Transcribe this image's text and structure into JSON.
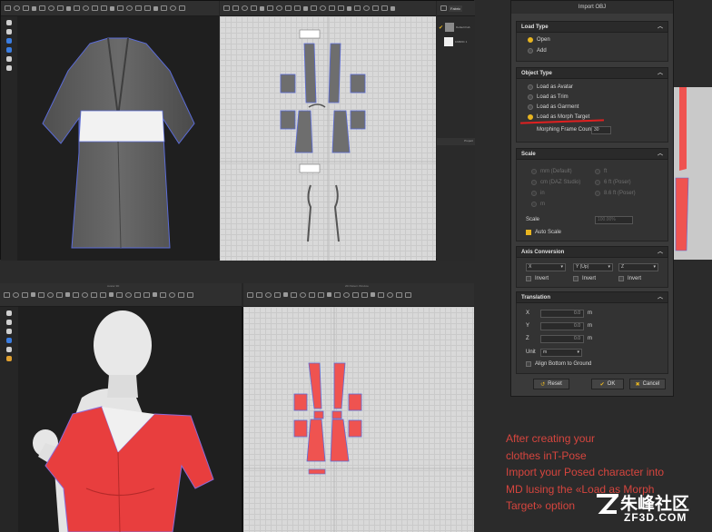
{
  "dialog": {
    "title": "Import OBJ",
    "load_type": {
      "header": "Load Type",
      "options": [
        "Open",
        "Add"
      ],
      "selected": "Open"
    },
    "object_type": {
      "header": "Object Type",
      "options": [
        "Load as Avatar",
        "Load as Trim",
        "Load as Garment",
        "Load as Morph Target"
      ],
      "selected": "Load as Morph Target",
      "frame_count_label": "Morphing Frame Count",
      "frame_count_value": "30"
    },
    "scale": {
      "header": "Scale",
      "options_left": [
        "mm (Default)",
        "cm (DAZ Studio)",
        "in",
        "m"
      ],
      "options_right": [
        "ft",
        "6 ft (Poser)",
        "8.6 ft (Poser)"
      ],
      "scale_label": "Scale",
      "scale_value": "100.00%",
      "auto_scale_label": "Auto Scale"
    },
    "axis_conversion": {
      "header": "Axis Conversion",
      "axes": [
        "X",
        "Y (Up)",
        "Z"
      ],
      "invert_label": "Invert"
    },
    "translation": {
      "header": "Translation",
      "fields": [
        {
          "label": "X",
          "value": "0.0",
          "unit": "m"
        },
        {
          "label": "Y",
          "value": "0.0",
          "unit": "m"
        },
        {
          "label": "Z",
          "value": "0.0",
          "unit": "m"
        }
      ],
      "unit_label": "Unit",
      "unit_value": "m",
      "align_label": "Align Bottom to Ground"
    },
    "buttons": {
      "reset": "Reset",
      "ok": "OK",
      "cancel": "Cancel"
    }
  },
  "top_window": {
    "panel_tabs": [
      "Fabric"
    ],
    "fabric_items": [
      "Default Fab",
      "FABRIC 1"
    ],
    "property_tab": "Propert"
  },
  "bottom_window": {
    "title_3d": "Avatar 3D",
    "title_2d": "2D Pattern Window"
  },
  "caption": "After creating your\nclothes inT-Pose\nImport your Posed character into\nMD lusing the «Load as Morph\nTarget» option",
  "watermark": {
    "logo": "朱峰社区",
    "sub": "ZF3D.COM"
  },
  "colors": {
    "accent": "#e8b520",
    "caption": "#d6453e",
    "piece_red": "#ef5350",
    "piece_grey": "#6e6e6e"
  }
}
